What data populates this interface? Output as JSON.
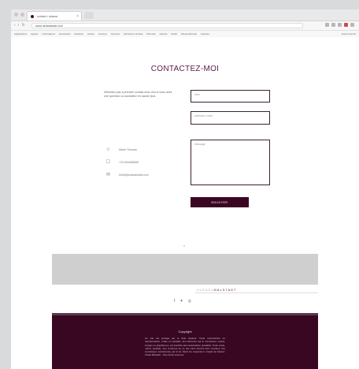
{
  "browser": {
    "tab_title": "contact • ulrarna",
    "url": "www.ulrabalstadt.com",
    "bookmarks": [
      "Applications",
      "Ajouter",
      "Informations",
      "Interessant",
      "Dossiers",
      "Cartes",
      "Contenu",
      "Services",
      "Dernieres minutes",
      "Mot-cles",
      "Favoris",
      "Outils",
      "Vitesse Bureau",
      "Importer"
    ],
    "bookmarks_right": "Autres favoris"
  },
  "contact": {
    "heading": "CONTACTEZ-MOI",
    "intro": "N'hésitez pas à prendre contact avec moi si vous avez une question ou souhaitez en savoir plus.",
    "name_placeholder": "Nom",
    "email_placeholder": "Adresse e-mail",
    "message_placeholder": "Message",
    "send_label": "ENVOYER",
    "contact_name": "Marie Thomas",
    "contact_phone": "+33 654456565",
    "contact_email": "hello@ulrabalstadt.com"
  },
  "banner": {
    "logo_part1": "ULRARA",
    "logo_part2": "BALSTADT"
  },
  "footer": {
    "title": "Copyright",
    "text": "Ce site est protégé par le droit d'auteur. Toute reproduction ou représentation, totale ou partielle, des éléments qui le composent, textes, images ou graphismes, est interdite sans autorisation préalable. Toute copie, même partielle, des contenus de ce site sans accord écrit constitue une contrefaçon sanctionnée par la loi. Merci de respecter le travail de l'auteur. Ulrara Balstadt - Tous droits réservés."
  },
  "colors": {
    "accent": "#3a0722",
    "heading": "#5a1a48"
  }
}
